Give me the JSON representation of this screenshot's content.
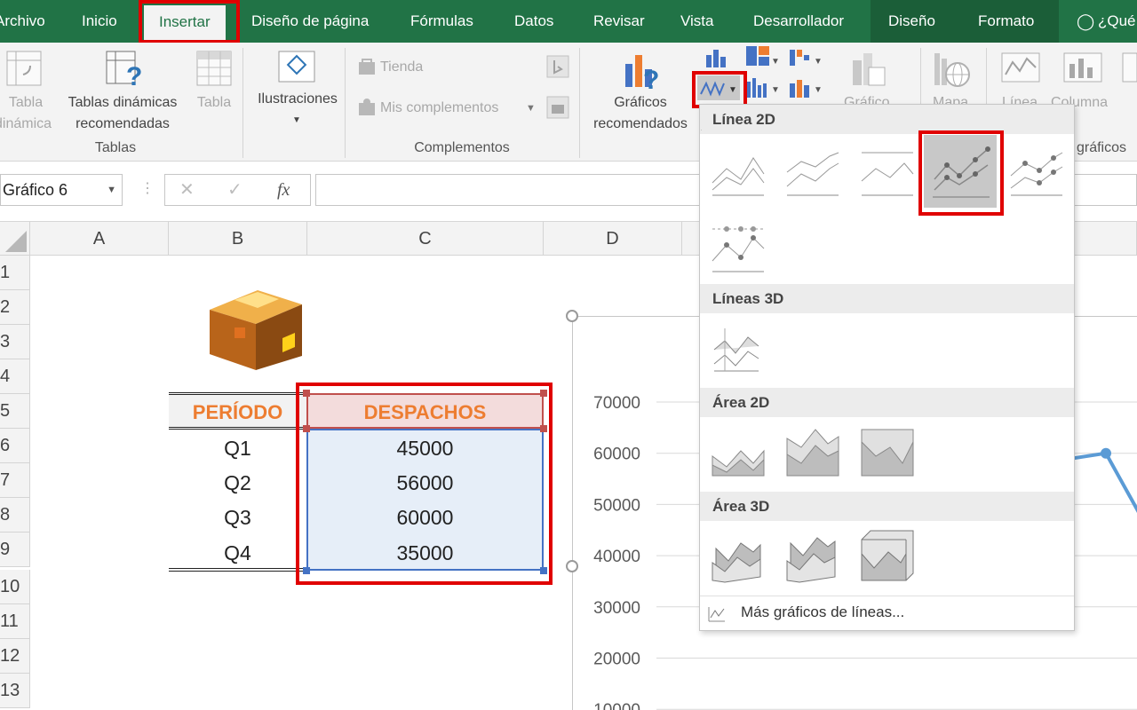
{
  "tabs": [
    "Archivo",
    "Inicio",
    "Insertar",
    "Diseño de página",
    "Fórmulas",
    "Datos",
    "Revisar",
    "Vista",
    "Desarrollador",
    "Diseño",
    "Formato",
    "¿Qué"
  ],
  "active_tab": "Insertar",
  "ribbon": {
    "tabla_dinamica": [
      "Tabla",
      "dinámica"
    ],
    "tablas_dinamicas_recomendadas": [
      "Tablas dinámicas",
      "recomendadas"
    ],
    "tabla": "Tabla",
    "group_tablas": "Tablas",
    "ilustraciones": "Ilustraciones",
    "tienda": "Tienda",
    "mis_complementos": "Mis complementos",
    "group_complementos": "Complementos",
    "graficos_recomendados": [
      "Gráficos",
      "recomendados"
    ],
    "grafico_partial": "Gráfico",
    "mapa_partial": "Mapa",
    "linea": "Línea",
    "columna": "Columna",
    "graficos_partial": "gráficos"
  },
  "formula_bar": {
    "name_box": "Gráfico 6",
    "cancel": "✕",
    "enter": "✓",
    "fx": "fx"
  },
  "grid": {
    "columns": [
      "A",
      "B",
      "C",
      "D"
    ],
    "rows": [
      "1",
      "2",
      "3",
      "4",
      "5",
      "6",
      "7",
      "8",
      "9",
      "10",
      "11",
      "12",
      "13"
    ],
    "header_periodo": "PERÍODO",
    "header_despachos": "DESPACHOS",
    "data": [
      {
        "periodo": "Q1",
        "despachos": "45000"
      },
      {
        "periodo": "Q2",
        "despachos": "56000"
      },
      {
        "periodo": "Q3",
        "despachos": "60000"
      },
      {
        "periodo": "Q4",
        "despachos": "35000"
      }
    ]
  },
  "chart": {
    "y_ticks": [
      "70000",
      "60000",
      "50000",
      "40000",
      "30000",
      "20000",
      "10000"
    ],
    "line_color": "#5b9bd5"
  },
  "chart_data": {
    "type": "line",
    "categories": [
      "Q1",
      "Q2",
      "Q3",
      "Q4"
    ],
    "values": [
      45000,
      56000,
      60000,
      35000
    ],
    "ylim": [
      0,
      70000
    ]
  },
  "gallery": {
    "linea_2d": "Línea 2D",
    "lineas_3d": "Líneas 3D",
    "area_2d": "Área 2D",
    "area_3d": "Área 3D",
    "mas_graficos": "Más gráficos de líneas..."
  },
  "colors": {
    "ribbon_green": "#217346",
    "highlight_red": "#e00000",
    "header_orange": "#ed7d31",
    "selection_blue": "#4472c4"
  }
}
